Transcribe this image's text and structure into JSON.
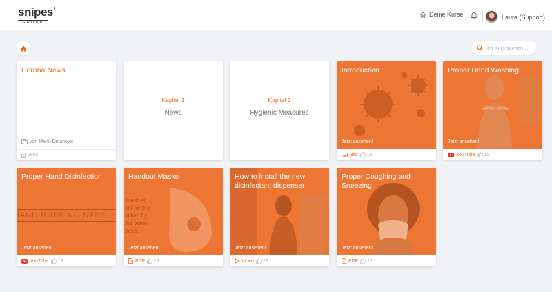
{
  "header": {
    "logo": {
      "word": "snipes",
      "sub": "GROUP"
    },
    "courses_label": "Deine Kurse",
    "user_name": "Laura (Support)"
  },
  "search": {
    "placeholder": "Im Kurs suchen..."
  },
  "colors": {
    "accent": "#f06a1e",
    "card_orange": "#ee7634",
    "background": "#f1f2f5"
  },
  "cards": [
    {
      "title": "Corona News",
      "author": "von Mario Dejanovic",
      "views": "2602"
    },
    {
      "chapter_label": "Kapitel 1",
      "chapter_name": "News"
    },
    {
      "chapter_label": "Kapitel 2",
      "chapter_name": "Hygienic Measures"
    },
    {
      "title": "Introduction",
      "cta": "Jetzt ansehen!",
      "type": "Bild",
      "likes": "16",
      "icon": "image-icon"
    },
    {
      "title": "Proper Hand Washing",
      "cta": "Jetzt ansehen!",
      "type": "YouTube",
      "likes": "15",
      "icon": "youtube-icon"
    },
    {
      "title": "Proper Hand Disinfection",
      "cta": "Jetzt ansehen!",
      "type": "YouTube",
      "likes": "15",
      "icon": "youtube-icon",
      "bg_text": "HAND RUBBING STEP"
    },
    {
      "title": "Handout Masks",
      "cta": "Jetzt ansehen!",
      "type": "PDF",
      "likes": "14",
      "icon": "pdf-icon",
      "bg_text": "fine dust\nent for the\nntified by\nthe valve\nmask."
    },
    {
      "title": "How to install the new disinfectant dispenser",
      "cta": "Jetzt ansehen!",
      "type": "Video",
      "likes": "22",
      "icon": "play-icon"
    },
    {
      "title": "Proper Coughing and Sneezing",
      "cta": "Jetzt ansehen!",
      "type": "PDF",
      "likes": "12",
      "icon": "pdf-icon"
    }
  ]
}
